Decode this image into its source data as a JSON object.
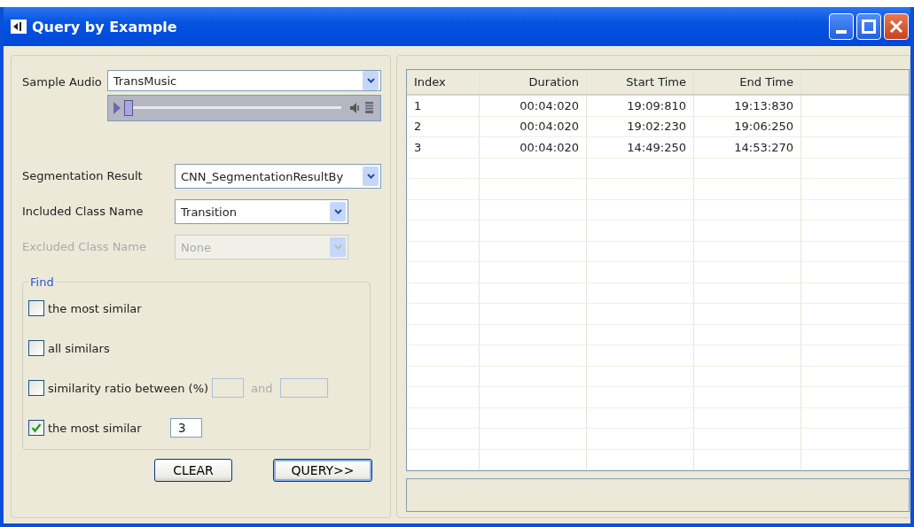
{
  "window": {
    "title": "Query by Example"
  },
  "sample_audio": {
    "label": "Sample Audio",
    "value": "TransMusic",
    "player": {
      "level": 0
    }
  },
  "fields": [
    {
      "label": "Segmentation Result",
      "value": "CNN_SegmentationResultBy",
      "disabled": false,
      "wide": true
    },
    {
      "label": "Included Class Name",
      "value": "Transition",
      "disabled": false,
      "wide": false
    },
    {
      "label": "Excluded Class Name",
      "value": "None",
      "disabled": true,
      "wide": false
    }
  ],
  "find": {
    "title": "Find",
    "options": [
      {
        "kind": "plain",
        "label": "the most similar",
        "checked": false
      },
      {
        "kind": "plain",
        "label": "all similars",
        "checked": false
      },
      {
        "kind": "range",
        "label": "similarity ratio between (%)",
        "checked": false,
        "and_label": "and"
      },
      {
        "kind": "count",
        "label": "the most similar",
        "checked": true,
        "value": "3"
      }
    ]
  },
  "buttons": [
    "CLEAR",
    "QUERY>>"
  ],
  "table": {
    "columns": [
      "Index",
      "Duration",
      "Start Time",
      "End Time"
    ],
    "rows": [
      [
        "1",
        "00:04:020",
        "19:09:810",
        "19:13:830"
      ],
      [
        "2",
        "00:04:020",
        "19:02:230",
        "19:06:250"
      ],
      [
        "3",
        "00:04:020",
        "14:49:250",
        "14:53:270"
      ]
    ]
  }
}
